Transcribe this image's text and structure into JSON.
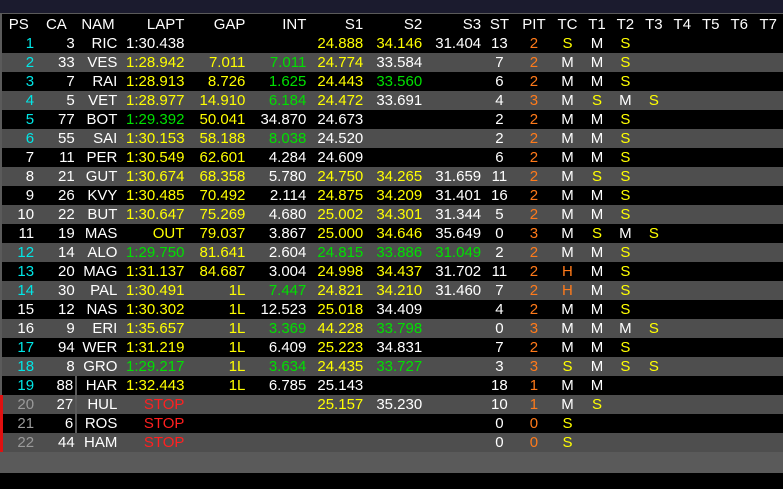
{
  "headers": [
    "PS",
    "CA",
    "NAM",
    "LAPT",
    "GAP",
    "INT",
    "S1",
    "S2",
    "S3",
    "ST",
    "PIT",
    "TC",
    "T1",
    "T2",
    "T3",
    "T4",
    "T5",
    "T6",
    "T7"
  ],
  "colors": {
    "white": "#ffffff",
    "yellow": "#ffff00",
    "green": "#00e000",
    "cyan": "#00e6e6",
    "gray": "#9a9a9a",
    "orange": "#ff7a1a",
    "red": "#ff2020"
  },
  "rows": [
    {
      "ps": "1",
      "ps_c": "cy",
      "ca": "3",
      "nam": "RIC",
      "lapt": "1:30.438",
      "lapt_c": "w",
      "gap": "",
      "gap_c": "w",
      "int": "",
      "int_c": "w",
      "s1": "24.888",
      "s1_c": "y",
      "s2": "34.146",
      "s2_c": "y",
      "s3": "31.404",
      "s3_c": "w",
      "st": "13",
      "pit": "2",
      "pit_c": "o",
      "tc": "S",
      "tc_c": "y",
      "t1": "M",
      "t1_c": "w",
      "t2": "S",
      "t2_c": "y",
      "t3": "",
      "t3_c": "y"
    },
    {
      "ps": "2",
      "ps_c": "cy",
      "ca": "33",
      "nam": "VES",
      "lapt": "1:28.942",
      "lapt_c": "y",
      "gap": "7.011",
      "gap_c": "y",
      "int": "7.011",
      "int_c": "g",
      "s1": "24.774",
      "s1_c": "y",
      "s2": "33.584",
      "s2_c": "w",
      "s3": "",
      "s3_c": "w",
      "st": "7",
      "pit": "2",
      "pit_c": "o",
      "tc": "M",
      "tc_c": "w",
      "t1": "M",
      "t1_c": "w",
      "t2": "S",
      "t2_c": "y",
      "t3": "",
      "t3_c": "y"
    },
    {
      "ps": "3",
      "ps_c": "cy",
      "ca": "7",
      "nam": "RAI",
      "lapt": "1:28.913",
      "lapt_c": "y",
      "gap": "8.726",
      "gap_c": "y",
      "int": "1.625",
      "int_c": "g",
      "s1": "24.443",
      "s1_c": "y",
      "s2": "33.560",
      "s2_c": "g",
      "s3": "",
      "s3_c": "w",
      "st": "6",
      "pit": "2",
      "pit_c": "o",
      "tc": "M",
      "tc_c": "w",
      "t1": "M",
      "t1_c": "w",
      "t2": "S",
      "t2_c": "y",
      "t3": "",
      "t3_c": "y"
    },
    {
      "ps": "4",
      "ps_c": "cy",
      "ca": "5",
      "nam": "VET",
      "lapt": "1:28.977",
      "lapt_c": "y",
      "gap": "14.910",
      "gap_c": "y",
      "int": "6.184",
      "int_c": "g",
      "s1": "24.472",
      "s1_c": "y",
      "s2": "33.691",
      "s2_c": "w",
      "s3": "",
      "s3_c": "w",
      "st": "4",
      "pit": "3",
      "pit_c": "o",
      "tc": "M",
      "tc_c": "w",
      "t1": "S",
      "t1_c": "y",
      "t2": "M",
      "t2_c": "w",
      "t3": "S",
      "t3_c": "y"
    },
    {
      "ps": "5",
      "ps_c": "cy",
      "ca": "77",
      "nam": "BOT",
      "lapt": "1:29.392",
      "lapt_c": "g",
      "gap": "50.041",
      "gap_c": "y",
      "int": "34.870",
      "int_c": "w",
      "s1": "24.673",
      "s1_c": "w",
      "s2": "",
      "s2_c": "w",
      "s3": "",
      "s3_c": "w",
      "st": "2",
      "pit": "2",
      "pit_c": "o",
      "tc": "M",
      "tc_c": "w",
      "t1": "M",
      "t1_c": "w",
      "t2": "S",
      "t2_c": "y",
      "t3": "",
      "t3_c": "y"
    },
    {
      "ps": "6",
      "ps_c": "cy",
      "ca": "55",
      "nam": "SAI",
      "lapt": "1:30.153",
      "lapt_c": "y",
      "gap": "58.188",
      "gap_c": "y",
      "int": "8.038",
      "int_c": "g",
      "s1": "24.520",
      "s1_c": "w",
      "s2": "",
      "s2_c": "w",
      "s3": "",
      "s3_c": "w",
      "st": "2",
      "pit": "2",
      "pit_c": "o",
      "tc": "M",
      "tc_c": "w",
      "t1": "M",
      "t1_c": "w",
      "t2": "S",
      "t2_c": "y",
      "t3": "",
      "t3_c": "y"
    },
    {
      "ps": "7",
      "ps_c": "w",
      "ca": "11",
      "nam": "PER",
      "lapt": "1:30.549",
      "lapt_c": "y",
      "gap": "62.601",
      "gap_c": "y",
      "int": "4.284",
      "int_c": "w",
      "s1": "24.609",
      "s1_c": "w",
      "s2": "",
      "s2_c": "w",
      "s3": "",
      "s3_c": "w",
      "st": "6",
      "pit": "2",
      "pit_c": "o",
      "tc": "M",
      "tc_c": "w",
      "t1": "M",
      "t1_c": "w",
      "t2": "S",
      "t2_c": "y",
      "t3": "",
      "t3_c": "y"
    },
    {
      "ps": "8",
      "ps_c": "w",
      "ca": "21",
      "nam": "GUT",
      "lapt": "1:30.674",
      "lapt_c": "y",
      "gap": "68.358",
      "gap_c": "y",
      "int": "5.780",
      "int_c": "w",
      "s1": "24.750",
      "s1_c": "y",
      "s2": "34.265",
      "s2_c": "y",
      "s3": "31.659",
      "s3_c": "w",
      "st": "11",
      "pit": "2",
      "pit_c": "o",
      "tc": "M",
      "tc_c": "w",
      "t1": "S",
      "t1_c": "y",
      "t2": "S",
      "t2_c": "y",
      "t3": "",
      "t3_c": "y"
    },
    {
      "ps": "9",
      "ps_c": "w",
      "ca": "26",
      "nam": "KVY",
      "lapt": "1:30.485",
      "lapt_c": "y",
      "gap": "70.492",
      "gap_c": "y",
      "int": "2.114",
      "int_c": "w",
      "s1": "24.875",
      "s1_c": "y",
      "s2": "34.209",
      "s2_c": "y",
      "s3": "31.401",
      "s3_c": "w",
      "st": "16",
      "pit": "2",
      "pit_c": "o",
      "tc": "M",
      "tc_c": "w",
      "t1": "M",
      "t1_c": "w",
      "t2": "S",
      "t2_c": "y",
      "t3": "",
      "t3_c": "y"
    },
    {
      "ps": "10",
      "ps_c": "w",
      "ca": "22",
      "nam": "BUT",
      "lapt": "1:30.647",
      "lapt_c": "y",
      "gap": "75.269",
      "gap_c": "y",
      "int": "4.680",
      "int_c": "w",
      "s1": "25.002",
      "s1_c": "y",
      "s2": "34.301",
      "s2_c": "y",
      "s3": "31.344",
      "s3_c": "w",
      "st": "5",
      "pit": "2",
      "pit_c": "o",
      "tc": "M",
      "tc_c": "w",
      "t1": "M",
      "t1_c": "w",
      "t2": "S",
      "t2_c": "y",
      "t3": "",
      "t3_c": "y"
    },
    {
      "ps": "11",
      "ps_c": "w",
      "ca": "19",
      "nam": "MAS",
      "lapt": "OUT",
      "lapt_c": "y",
      "gap": "79.037",
      "gap_c": "y",
      "int": "3.867",
      "int_c": "w",
      "s1": "25.000",
      "s1_c": "y",
      "s2": "34.646",
      "s2_c": "y",
      "s3": "35.649",
      "s3_c": "w",
      "st": "0",
      "pit": "3",
      "pit_c": "o",
      "tc": "M",
      "tc_c": "w",
      "t1": "S",
      "t1_c": "y",
      "t2": "M",
      "t2_c": "w",
      "t3": "S",
      "t3_c": "y"
    },
    {
      "ps": "12",
      "ps_c": "cy",
      "ca": "14",
      "nam": "ALO",
      "lapt": "1:29.750",
      "lapt_c": "g",
      "gap": "81.641",
      "gap_c": "y",
      "int": "2.604",
      "int_c": "w",
      "s1": "24.815",
      "s1_c": "g",
      "s2": "33.886",
      "s2_c": "g",
      "s3": "31.049",
      "s3_c": "g",
      "st": "2",
      "pit": "2",
      "pit_c": "o",
      "tc": "M",
      "tc_c": "w",
      "t1": "M",
      "t1_c": "w",
      "t2": "S",
      "t2_c": "y",
      "t3": "",
      "t3_c": "y"
    },
    {
      "ps": "13",
      "ps_c": "cy",
      "ca": "20",
      "nam": "MAG",
      "lapt": "1:31.137",
      "lapt_c": "y",
      "gap": "84.687",
      "gap_c": "y",
      "int": "3.004",
      "int_c": "w",
      "s1": "24.998",
      "s1_c": "y",
      "s2": "34.437",
      "s2_c": "y",
      "s3": "31.702",
      "s3_c": "w",
      "st": "11",
      "pit": "2",
      "pit_c": "o",
      "tc": "H",
      "tc_c": "o",
      "t1": "M",
      "t1_c": "w",
      "t2": "S",
      "t2_c": "y",
      "t3": "",
      "t3_c": "y"
    },
    {
      "ps": "14",
      "ps_c": "cy",
      "ca": "30",
      "nam": "PAL",
      "lapt": "1:30.491",
      "lapt_c": "y",
      "gap": "1L",
      "gap_c": "y",
      "int": "7.447",
      "int_c": "g",
      "s1": "24.821",
      "s1_c": "y",
      "s2": "34.210",
      "s2_c": "y",
      "s3": "31.460",
      "s3_c": "w",
      "st": "7",
      "pit": "2",
      "pit_c": "o",
      "tc": "H",
      "tc_c": "o",
      "t1": "M",
      "t1_c": "w",
      "t2": "S",
      "t2_c": "y",
      "t3": "",
      "t3_c": "y"
    },
    {
      "ps": "15",
      "ps_c": "w",
      "ca": "12",
      "nam": "NAS",
      "lapt": "1:30.302",
      "lapt_c": "y",
      "gap": "1L",
      "gap_c": "y",
      "int": "12.523",
      "int_c": "w",
      "s1": "25.018",
      "s1_c": "y",
      "s2": "34.409",
      "s2_c": "w",
      "s3": "",
      "s3_c": "w",
      "st": "4",
      "pit": "2",
      "pit_c": "o",
      "tc": "M",
      "tc_c": "w",
      "t1": "M",
      "t1_c": "w",
      "t2": "S",
      "t2_c": "y",
      "t3": "",
      "t3_c": "y"
    },
    {
      "ps": "16",
      "ps_c": "w",
      "ca": "9",
      "nam": "ERI",
      "lapt": "1:35.657",
      "lapt_c": "y",
      "gap": "1L",
      "gap_c": "y",
      "int": "3.369",
      "int_c": "g",
      "s1": "44.228",
      "s1_c": "y",
      "s2": "33.798",
      "s2_c": "g",
      "s3": "",
      "s3_c": "w",
      "st": "0",
      "pit": "3",
      "pit_c": "o",
      "tc": "M",
      "tc_c": "w",
      "t1": "M",
      "t1_c": "w",
      "t2": "M",
      "t2_c": "w",
      "t3": "S",
      "t3_c": "y"
    },
    {
      "ps": "17",
      "ps_c": "cy",
      "ca": "94",
      "nam": "WER",
      "lapt": "1:31.219",
      "lapt_c": "y",
      "gap": "1L",
      "gap_c": "y",
      "int": "6.409",
      "int_c": "w",
      "s1": "25.223",
      "s1_c": "y",
      "s2": "34.831",
      "s2_c": "w",
      "s3": "",
      "s3_c": "w",
      "st": "7",
      "pit": "2",
      "pit_c": "o",
      "tc": "M",
      "tc_c": "w",
      "t1": "M",
      "t1_c": "w",
      "t2": "S",
      "t2_c": "y",
      "t3": "",
      "t3_c": "y"
    },
    {
      "ps": "18",
      "ps_c": "cy",
      "ca": "8",
      "nam": "GRO",
      "lapt": "1:29.217",
      "lapt_c": "g",
      "gap": "1L",
      "gap_c": "y",
      "int": "3.634",
      "int_c": "g",
      "s1": "24.435",
      "s1_c": "y",
      "s2": "33.727",
      "s2_c": "g",
      "s3": "",
      "s3_c": "w",
      "st": "3",
      "pit": "3",
      "pit_c": "o",
      "tc": "S",
      "tc_c": "y",
      "t1": "M",
      "t1_c": "w",
      "t2": "S",
      "t2_c": "y",
      "t3": "S",
      "t3_c": "y"
    },
    {
      "ps": "19",
      "ps_c": "cy",
      "ca": "88",
      "nam": "HAR",
      "lapt": "1:32.443",
      "lapt_c": "y",
      "gap": "1L",
      "gap_c": "y",
      "int": "6.785",
      "int_c": "w",
      "s1": "25.143",
      "s1_c": "w",
      "s2": "",
      "s2_c": "w",
      "s3": "",
      "s3_c": "w",
      "st": "18",
      "pit": "1",
      "pit_c": "o",
      "tc": "M",
      "tc_c": "w",
      "t1": "M",
      "t1_c": "w",
      "t2": "",
      "t2_c": "y",
      "t3": "",
      "t3_c": "y"
    },
    {
      "ps": "20",
      "ps_c": "gr",
      "ca": "27",
      "nam": "HUL",
      "lapt": "STOP",
      "lapt_c": "red",
      "gap": "",
      "gap_c": "y",
      "int": "",
      "int_c": "w",
      "s1": "25.157",
      "s1_c": "y",
      "s2": "35.230",
      "s2_c": "w",
      "s3": "",
      "s3_c": "w",
      "st": "10",
      "pit": "1",
      "pit_c": "o",
      "tc": "M",
      "tc_c": "w",
      "t1": "S",
      "t1_c": "y",
      "t2": "",
      "t2_c": "y",
      "t3": "",
      "t3_c": "y",
      "retired": true
    },
    {
      "ps": "21",
      "ps_c": "gr",
      "ca": "6",
      "nam": "ROS",
      "lapt": "STOP",
      "lapt_c": "red",
      "gap": "",
      "gap_c": "y",
      "int": "",
      "int_c": "w",
      "s1": "",
      "s1_c": "w",
      "s2": "",
      "s2_c": "w",
      "s3": "",
      "s3_c": "w",
      "st": "0",
      "pit": "0",
      "pit_c": "o",
      "tc": "S",
      "tc_c": "y",
      "t1": "",
      "t1_c": "w",
      "t2": "",
      "t2_c": "y",
      "t3": "",
      "t3_c": "y",
      "retired": true
    },
    {
      "ps": "22",
      "ps_c": "gr",
      "ca": "44",
      "nam": "HAM",
      "lapt": "STOP",
      "lapt_c": "red",
      "gap": "",
      "gap_c": "y",
      "int": "",
      "int_c": "w",
      "s1": "",
      "s1_c": "w",
      "s2": "",
      "s2_c": "w",
      "s3": "",
      "s3_c": "w",
      "st": "0",
      "pit": "0",
      "pit_c": "o",
      "tc": "S",
      "tc_c": "y",
      "t1": "",
      "t1_c": "w",
      "t2": "",
      "t2_c": "y",
      "t3": "",
      "t3_c": "y",
      "retired": true
    }
  ]
}
